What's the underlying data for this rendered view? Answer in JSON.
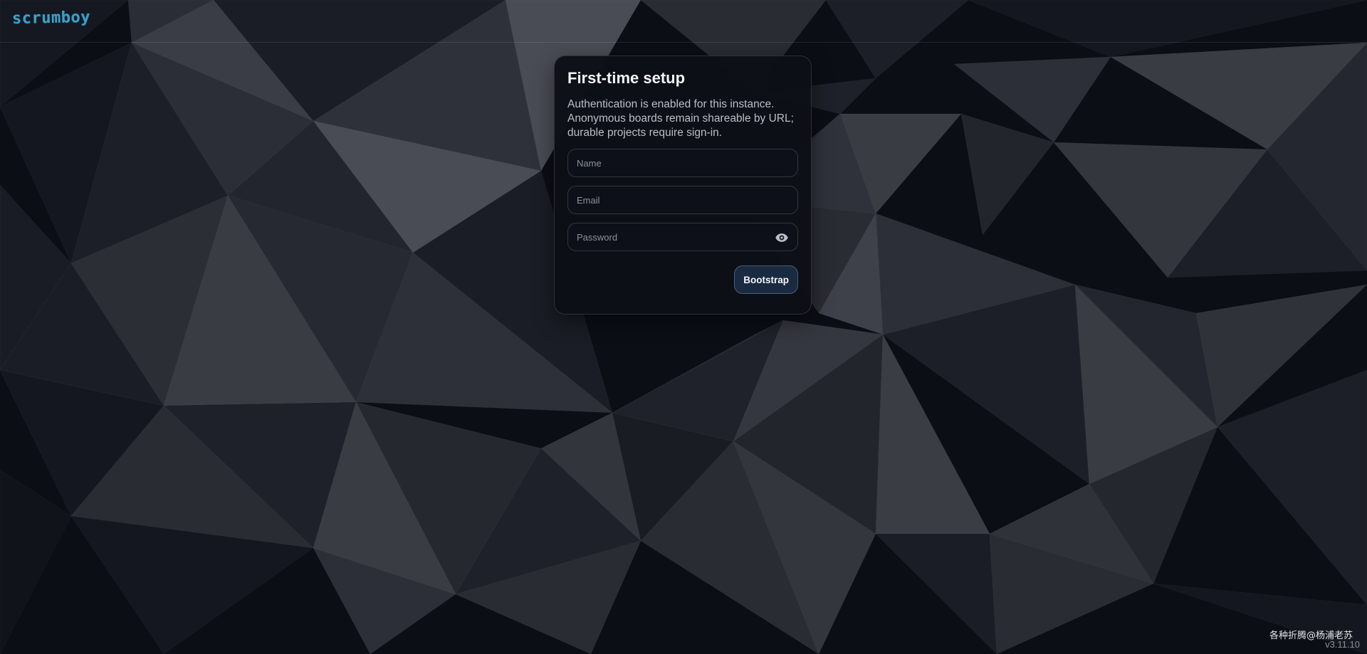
{
  "app": {
    "logo_text": "scrumboy",
    "brand_color": "#3aa0c8"
  },
  "setup_card": {
    "title": "First-time setup",
    "description": "Authentication is enabled for this instance. Anonymous boards remain shareable by URL; durable projects require sign-in.",
    "fields": {
      "name": {
        "placeholder": "Name",
        "value": ""
      },
      "email": {
        "placeholder": "Email",
        "value": ""
      },
      "password": {
        "placeholder": "Password",
        "value": "",
        "toggle_icon": "eye-icon"
      }
    },
    "submit_label": "Bootstrap"
  },
  "footer": {
    "watermark": "各种折腾@杨浦老苏",
    "version": "v3.11.10"
  }
}
